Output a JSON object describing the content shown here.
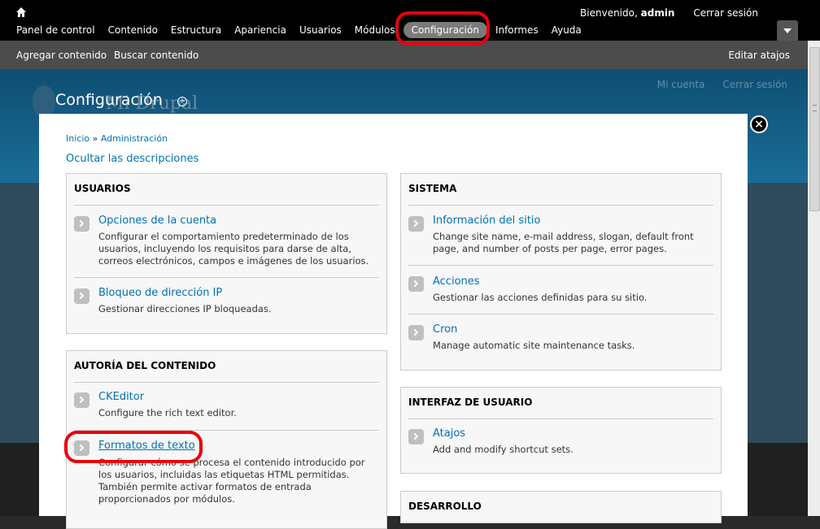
{
  "toolbar": {
    "welcome_prefix": "Bienvenido,",
    "username": "admin",
    "logout": "Cerrar sesión",
    "menu": [
      "Panel de control",
      "Contenido",
      "Estructura",
      "Apariencia",
      "Usuarios",
      "Módulos",
      "Configuración",
      "Informes",
      "Ayuda"
    ],
    "active": "Configuración"
  },
  "shortcuts": {
    "add_content": "Agregar contenido",
    "find_content": "Buscar contenido",
    "edit_shortcuts": "Editar atajos"
  },
  "background": {
    "my_account": "Mi cuenta",
    "logout": "Cerrar sesión",
    "site_name": "Mi Drupal"
  },
  "page": {
    "title": "Configuración"
  },
  "overlay": {
    "breadcrumb_home": "Inicio",
    "breadcrumb_sep": "»",
    "breadcrumb_admin": "Administración",
    "toggle_descriptions": "Ocultar las descripciones",
    "panels": {
      "usuarios": {
        "title": "USUARIOS",
        "items": [
          {
            "label": "Opciones de la cuenta",
            "desc": "Configurar el comportamiento predeterminado de los usuarios, incluyendo los requisitos para darse de alta, correos electrónicos, campos e imágenes de los usuarios."
          },
          {
            "label": "Bloqueo de dirección IP",
            "desc": "Gestionar direcciones IP bloqueadas."
          }
        ]
      },
      "autoria": {
        "title": "AUTORÍA DEL CONTENIDO",
        "items": [
          {
            "label": "CKEditor",
            "desc": "Configure the rich text editor."
          },
          {
            "label": "Formatos de texto",
            "desc": "Configurar cómo se procesa el contenido introducido por los usuarios, incluidas las etiquetas HTML permitidas. También permite activar formatos de entrada proporcionados por módulos."
          }
        ]
      },
      "sistema": {
        "title": "SISTEMA",
        "items": [
          {
            "label": "Información del sitio",
            "desc": "Change site name, e-mail address, slogan, default front page, and number of posts per page, error pages."
          },
          {
            "label": "Acciones",
            "desc": "Gestionar las acciones definidas para su sitio."
          },
          {
            "label": "Cron",
            "desc": "Manage automatic site maintenance tasks."
          }
        ]
      },
      "interfaz": {
        "title": "INTERFAZ DE USUARIO",
        "items": [
          {
            "label": "Atajos",
            "desc": "Add and modify shortcut sets."
          }
        ]
      },
      "desarrollo": {
        "title": "DESARROLLO"
      }
    }
  },
  "colors": {
    "link": "#0071b3",
    "annotation": "#e8000d",
    "toolbar_bg": "#000000"
  }
}
